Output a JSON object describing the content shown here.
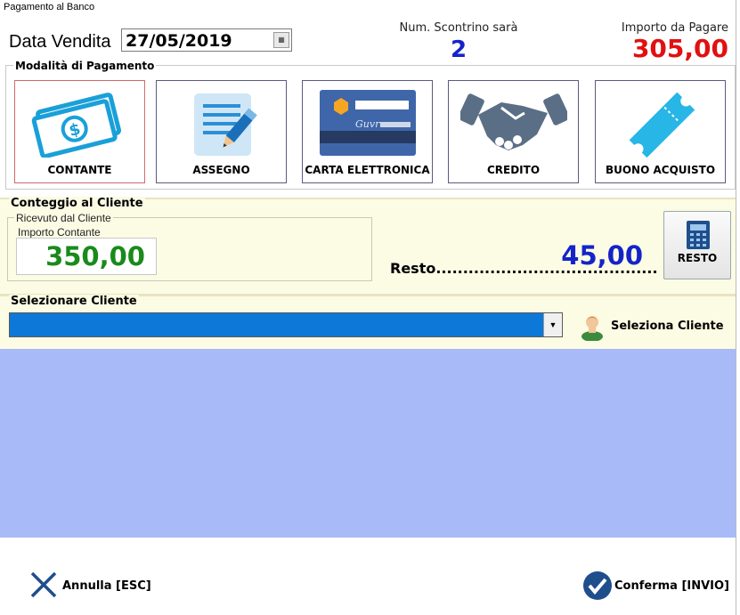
{
  "window": {
    "title": "Pagamento al Banco"
  },
  "header": {
    "date_label": "Data Vendita",
    "date_value": "27/05/2019",
    "receipt_label": "Num. Scontrino sarà",
    "receipt_value": "2",
    "amount_label": "Importo da Pagare",
    "amount_value": "305,00"
  },
  "payment": {
    "group_title": "Modalità di Pagamento",
    "methods": [
      {
        "label": "CONTANTE",
        "icon": "cash-icon",
        "selected": true
      },
      {
        "label": "ASSEGNO",
        "icon": "check-icon"
      },
      {
        "label": "CARTA ELETTRONICA",
        "icon": "credit-card-icon"
      },
      {
        "label": "CREDITO",
        "icon": "handshake-icon"
      },
      {
        "label": "BUONO ACQUISTO",
        "icon": "voucher-icon"
      }
    ]
  },
  "count": {
    "group_title": "Conteggio al Cliente",
    "received_title": "Ricevuto dal Cliente",
    "cash_label": "Importo Contante",
    "cash_value": "350,00",
    "change_label": "Resto.........................................",
    "change_value": "45,00",
    "change_button": "RESTO"
  },
  "client": {
    "group_title": "Selezionare Cliente",
    "selected_value": "",
    "select_button": "Seleziona Cliente"
  },
  "footer": {
    "cancel_label": "Annulla [ESC]",
    "confirm_label": "Conferma [INVIO]"
  },
  "colors": {
    "receipt_number": "#1424c8",
    "amount_due": "#e21010",
    "cash_amount": "#1a8a1a",
    "change_amount": "#1424c8",
    "client_select_bg": "#0e78d8",
    "empty_area": "#a8baf8",
    "count_panel_bg": "#fcfbe4"
  }
}
